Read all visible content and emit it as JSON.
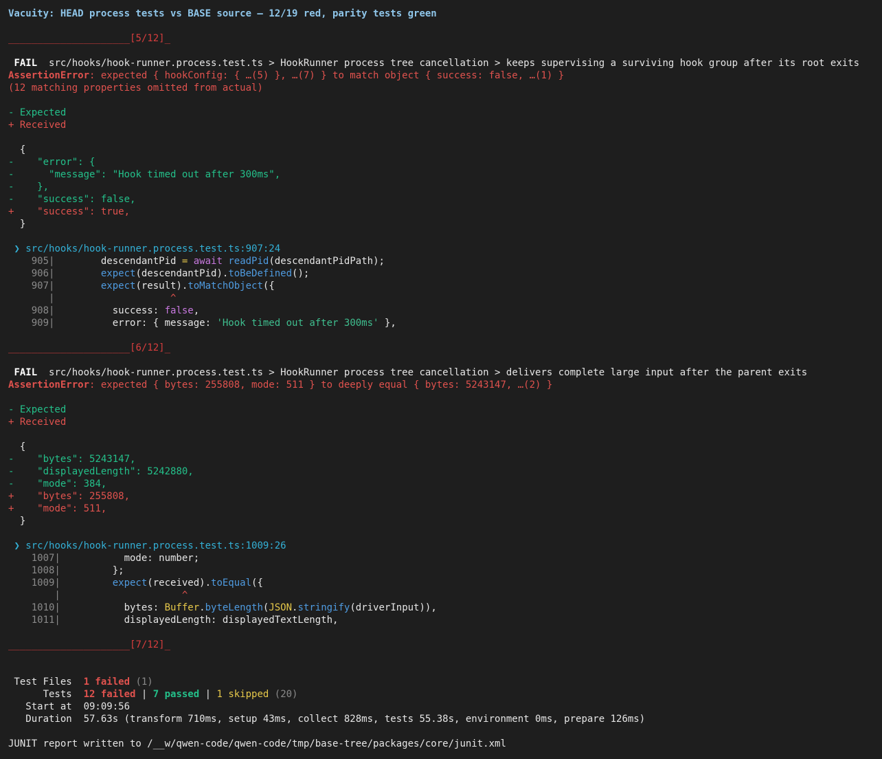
{
  "title": "Vacuity: HEAD process tests vs BASE source — 12/19 red, parity tests green",
  "failures": [
    {
      "separator": "_____________________",
      "counter": "[5/12]",
      "fail_label": "FAIL",
      "test_path": "src/hooks/hook-runner.process.test.ts > HookRunner process tree cancellation > keeps supervising a surviving hook group after its root exits",
      "error_type": "AssertionError",
      "error_message": ": expected { hookConfig: { …(5) }, …(7) } to match object { success: false, …(1) }",
      "error_note": "(12 matching properties omitted from actual)",
      "expected_label": "- Expected",
      "received_label": "+ Received",
      "diff_open": "  {",
      "diff_lines": [
        {
          "sign": "-",
          "text": "    \"error\": {",
          "kind": "expected"
        },
        {
          "sign": "-",
          "text": "      \"message\": \"Hook timed out after 300ms\",",
          "kind": "expected"
        },
        {
          "sign": "-",
          "text": "    },",
          "kind": "expected"
        },
        {
          "sign": "-",
          "text": "    \"success\": false,",
          "kind": "expected"
        },
        {
          "sign": "+",
          "text": "    \"success\": true,",
          "kind": "received"
        }
      ],
      "diff_close": "  }",
      "location": "❯ src/hooks/hook-runner.process.test.ts:907:24",
      "code": [
        {
          "no": "905",
          "segs": [
            [
              "white",
              "        descendantPid "
            ],
            [
              "yellow",
              "="
            ],
            [
              "white",
              " "
            ],
            [
              "magenta",
              "await"
            ],
            [
              "white",
              " "
            ],
            [
              "blue",
              "readPid"
            ],
            [
              "white",
              "(descendantPidPath);"
            ]
          ]
        },
        {
          "no": "906",
          "segs": [
            [
              "white",
              "        "
            ],
            [
              "blue",
              "expect"
            ],
            [
              "white",
              "(descendantPid)."
            ],
            [
              "blue",
              "toBeDefined"
            ],
            [
              "white",
              "();"
            ]
          ]
        },
        {
          "no": "907",
          "segs": [
            [
              "white",
              "        "
            ],
            [
              "blue",
              "expect"
            ],
            [
              "white",
              "(result)."
            ],
            [
              "blue",
              "toMatchObject"
            ],
            [
              "white",
              "({"
            ]
          ]
        },
        {
          "no": "   ",
          "segs": [
            [
              "white",
              "                    "
            ],
            [
              "red",
              "^"
            ]
          ]
        },
        {
          "no": "908",
          "segs": [
            [
              "white",
              "          success: "
            ],
            [
              "magenta",
              "false"
            ],
            [
              "white",
              ","
            ]
          ]
        },
        {
          "no": "909",
          "segs": [
            [
              "white",
              "          error: { message: "
            ],
            [
              "str",
              "'Hook timed out after 300ms'"
            ],
            [
              "white",
              " },"
            ]
          ]
        }
      ]
    },
    {
      "separator": "_____________________",
      "counter": "[6/12]",
      "fail_label": "FAIL",
      "test_path": "src/hooks/hook-runner.process.test.ts > HookRunner process tree cancellation > delivers complete large input after the parent exits",
      "error_type": "AssertionError",
      "error_message": ": expected { bytes: 255808, mode: 511 } to deeply equal { bytes: 5243147, …(2) }",
      "error_note": "",
      "expected_label": "- Expected",
      "received_label": "+ Received",
      "diff_open": "  {",
      "diff_lines": [
        {
          "sign": "-",
          "text": "    \"bytes\": 5243147,",
          "kind": "expected"
        },
        {
          "sign": "-",
          "text": "    \"displayedLength\": 5242880,",
          "kind": "expected"
        },
        {
          "sign": "-",
          "text": "    \"mode\": 384,",
          "kind": "expected"
        },
        {
          "sign": "+",
          "text": "    \"bytes\": 255808,",
          "kind": "received"
        },
        {
          "sign": "+",
          "text": "    \"mode\": 511,",
          "kind": "received"
        }
      ],
      "diff_close": "  }",
      "location": "❯ src/hooks/hook-runner.process.test.ts:1009:26",
      "code": [
        {
          "no": "1007",
          "segs": [
            [
              "white",
              "           mode: number;"
            ]
          ]
        },
        {
          "no": "1008",
          "segs": [
            [
              "white",
              "         };"
            ]
          ]
        },
        {
          "no": "1009",
          "segs": [
            [
              "white",
              "         "
            ],
            [
              "blue",
              "expect"
            ],
            [
              "white",
              "(received)."
            ],
            [
              "blue",
              "toEqual"
            ],
            [
              "white",
              "({"
            ]
          ]
        },
        {
          "no": "    ",
          "segs": [
            [
              "white",
              "                     "
            ],
            [
              "red",
              "^"
            ]
          ]
        },
        {
          "no": "1010",
          "segs": [
            [
              "white",
              "           bytes: "
            ],
            [
              "yellow",
              "Buffer"
            ],
            [
              "white",
              "."
            ],
            [
              "blue",
              "byteLength"
            ],
            [
              "white",
              "("
            ],
            [
              "yellow",
              "JSON"
            ],
            [
              "white",
              "."
            ],
            [
              "blue",
              "stringify"
            ],
            [
              "white",
              "(driverInput)),"
            ]
          ]
        },
        {
          "no": "1011",
          "segs": [
            [
              "white",
              "           displayedLength: displayedTextLength,"
            ]
          ]
        }
      ]
    }
  ],
  "last_separator": {
    "line": "_____________________",
    "counter": "[7/12]"
  },
  "summary": {
    "files_label": " Test Files",
    "files_failed": "1 failed",
    "files_total": "(1)",
    "tests_label": "      Tests",
    "tests_failed": "12 failed",
    "tests_passed": "7 passed",
    "tests_skipped": "1 skipped",
    "tests_total": "(20)",
    "start_label": "   Start at",
    "start_value": "09:09:56",
    "duration_label": "   Duration",
    "duration_value": "57.63s (transform 710ms, setup 43ms, collect 828ms, tests 55.38s, environment 0ms, prepare 126ms)"
  },
  "junit": "JUNIT report written to /__w/qwen-code/qwen-code/tmp/base-tree/packages/core/junit.xml"
}
